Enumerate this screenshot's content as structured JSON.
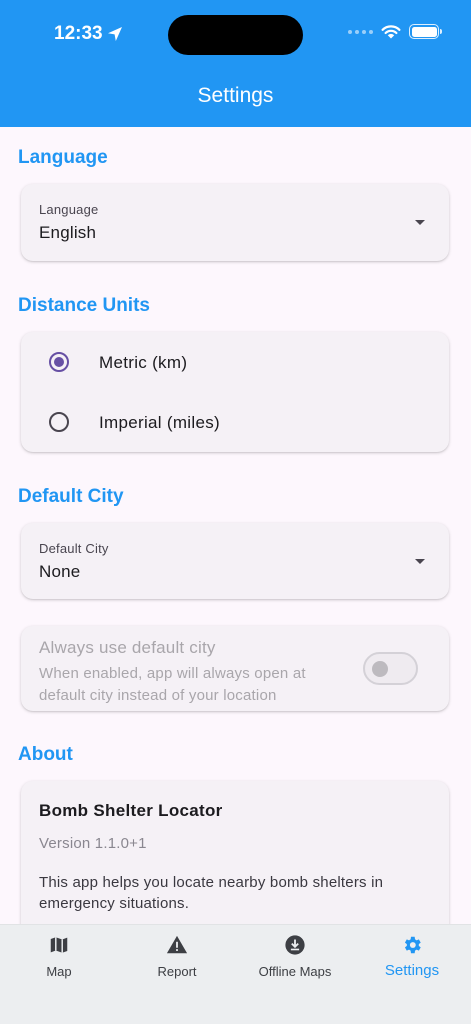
{
  "status_bar": {
    "time": "12:33"
  },
  "appbar": {
    "title": "Settings"
  },
  "language": {
    "section_title": "Language",
    "dropdown_label": "Language",
    "dropdown_value": "English"
  },
  "distance_units": {
    "section_title": "Distance Units",
    "options": [
      {
        "label": "Metric (km)",
        "selected": true
      },
      {
        "label": "Imperial (miles)",
        "selected": false
      }
    ]
  },
  "default_city": {
    "section_title": "Default City",
    "dropdown_label": "Default City",
    "dropdown_value": "None",
    "always_use": {
      "title": "Always use default city",
      "subtitle": "When enabled, app will always open at default city instead of your location",
      "enabled": false
    }
  },
  "about": {
    "section_title": "About",
    "app_name": "Bomb Shelter Locator",
    "version": "Version 1.1.0+1",
    "description": "This app helps you locate nearby bomb shelters in emergency situations."
  },
  "bottom_nav": {
    "items": [
      {
        "label": "Map",
        "icon": "map-icon",
        "active": false
      },
      {
        "label": "Report",
        "icon": "warning-icon",
        "active": false
      },
      {
        "label": "Offline Maps",
        "icon": "download-icon",
        "active": false
      },
      {
        "label": "Settings",
        "icon": "gear-icon",
        "active": true
      }
    ]
  },
  "colors": {
    "primary": "#2196f3",
    "radio_selected": "#6750a4",
    "background": "#fdf7fd",
    "card": "#f5f1f6"
  }
}
